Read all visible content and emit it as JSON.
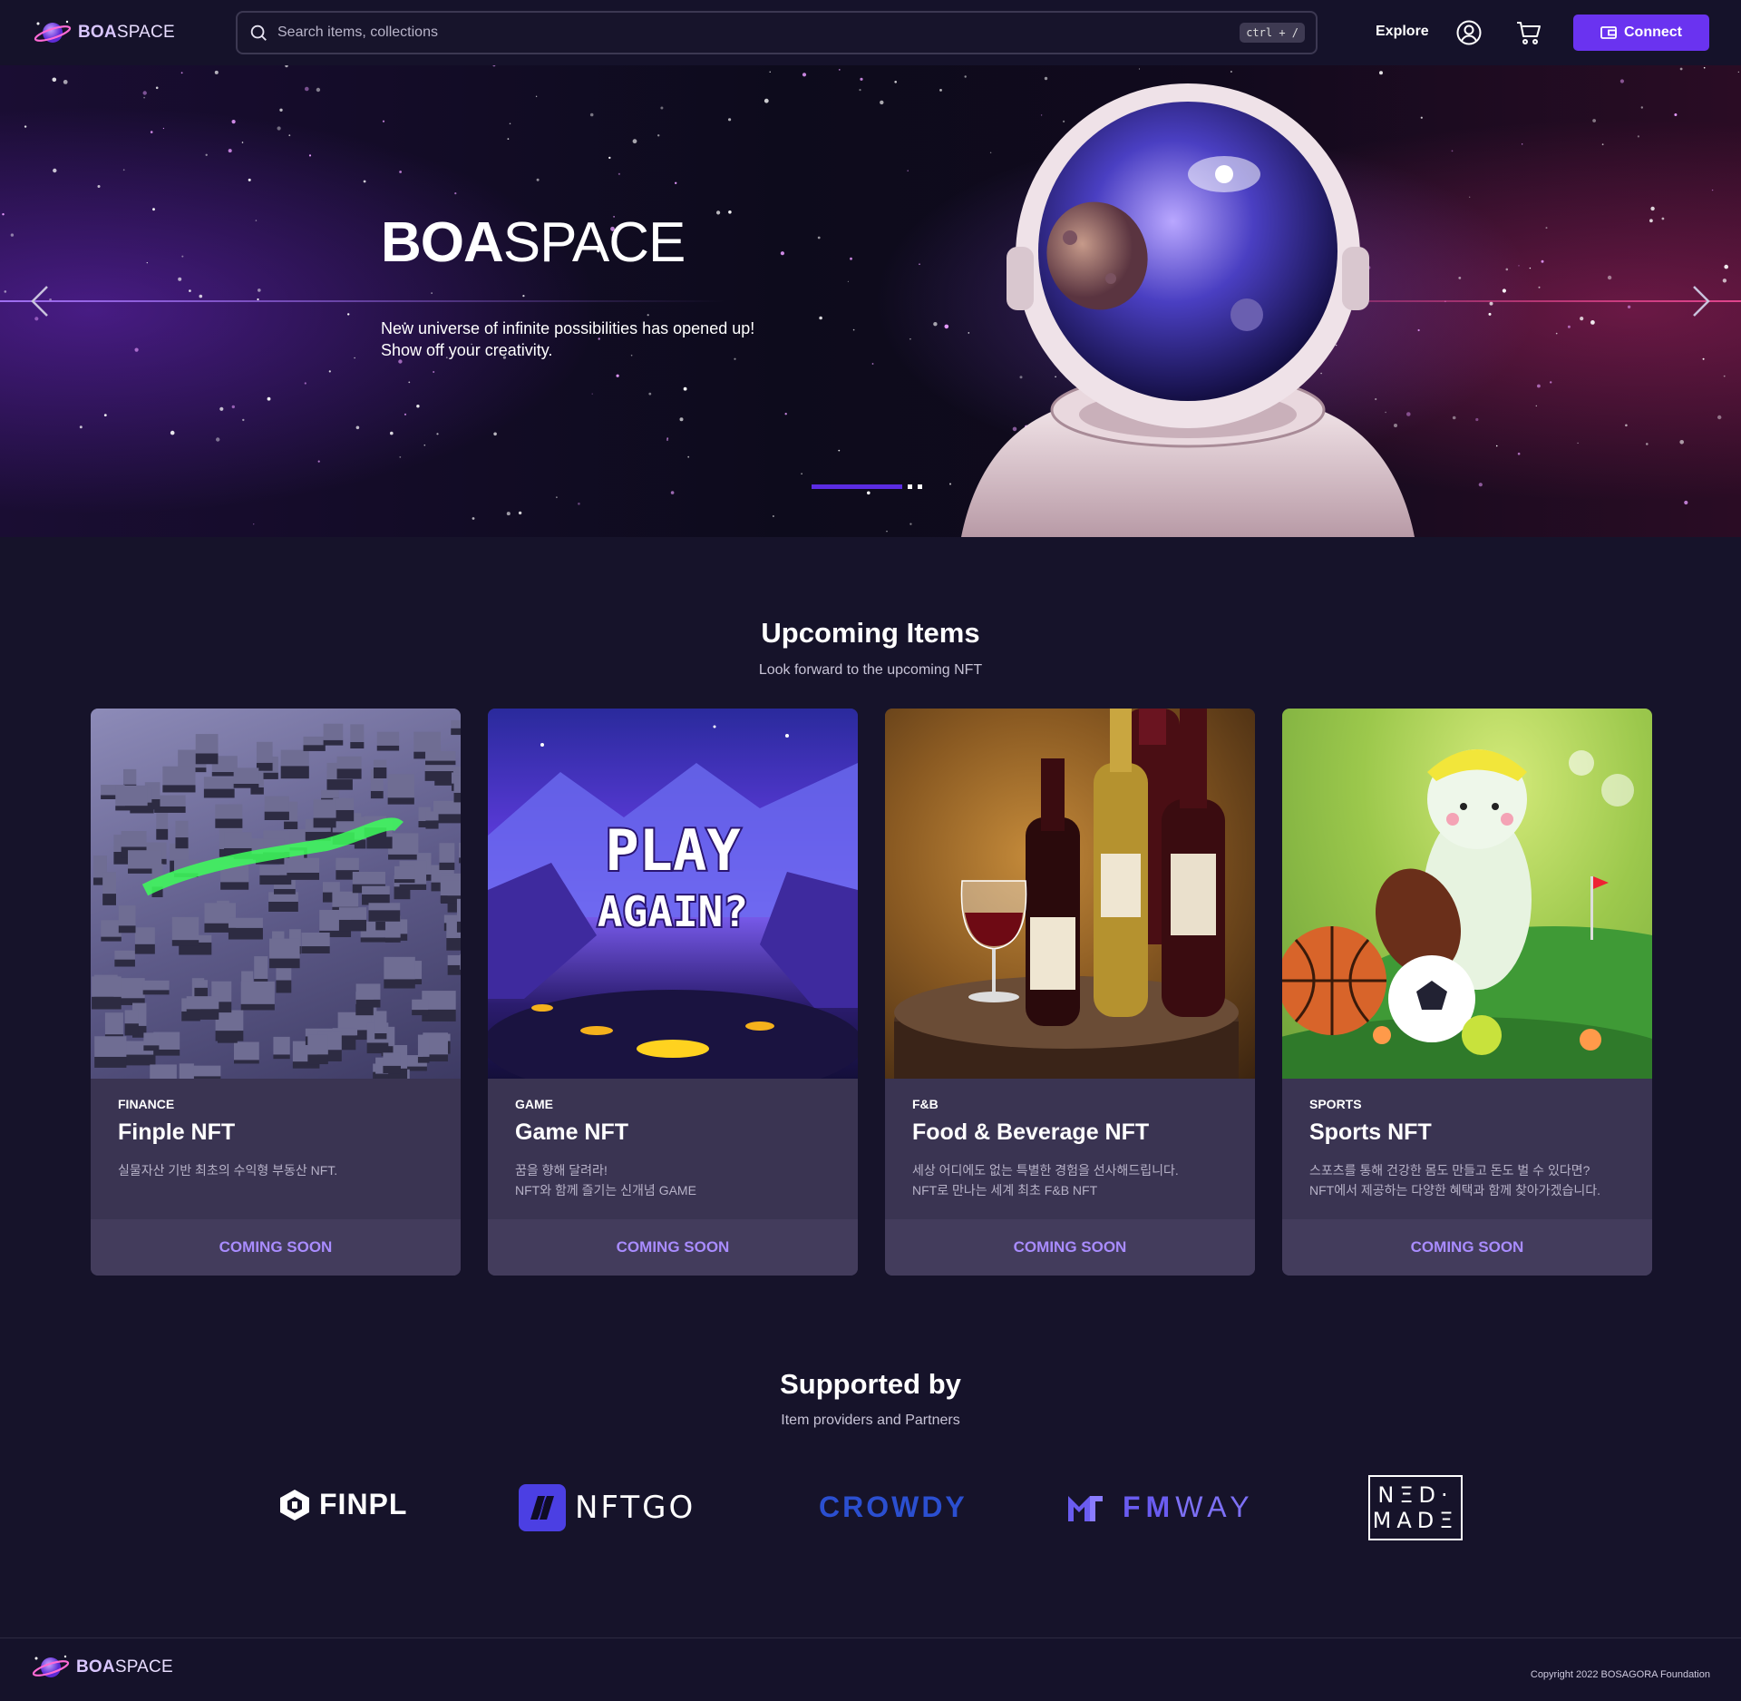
{
  "header": {
    "logo_bold": "BOA",
    "logo_light": "SPACE",
    "search_placeholder": "Search items, collections",
    "search_shortcut": "ctrl + /",
    "nav_explore": "Explore",
    "connect_label": "Connect"
  },
  "hero": {
    "title_bold": "BOA",
    "title_light": "SPACE",
    "subtitle_line1": "New universe of infinite possibilities has opened up!",
    "subtitle_line2": "Show off your creativity.",
    "active_slide": 1,
    "slide_count": 3
  },
  "upcoming": {
    "title": "Upcoming Items",
    "subtitle": "Look forward to the upcoming NFT",
    "cards": [
      {
        "category": "FINANCE",
        "title": "Finple NFT",
        "description": "실물자산 기반 최초의 수익형 부동산 NFT.",
        "action": "COMING SOON"
      },
      {
        "category": "GAME",
        "title": "Game NFT",
        "description": "꿈을 향해 달려라!\nNFT와 함께 즐기는 신개념 GAME",
        "action": "COMING SOON",
        "image_text_1": "PLAY",
        "image_text_2": "AGAIN?"
      },
      {
        "category": "F&B",
        "title": "Food & Beverage NFT",
        "description": "세상 어디에도 없는 특별한 경험을 선사해드립니다.\nNFT로 만나는 세계 최초 F&B NFT",
        "action": "COMING SOON"
      },
      {
        "category": "SPORTS",
        "title": "Sports NFT",
        "description": "스포츠를 통해 건강한 몸도 만들고 돈도 벌 수 있다면?\nNFT에서 제공하는 다양한 혜택과 함께 찾아가겠습니다.",
        "action": "COMING SOON"
      }
    ]
  },
  "supported": {
    "title": "Supported by",
    "subtitle": "Item providers and Partners",
    "partners": [
      "FINPL",
      "NFTGO",
      "CROWDY",
      "FMWAY",
      "NEED MADE"
    ],
    "nftgo_text": "NFTGO",
    "fmway_fm": "FM",
    "fmway_way": "WAY",
    "needmade_line1": "NΞD·",
    "needmade_line2": "MADΞ"
  },
  "footer": {
    "logo_bold": "BOA",
    "logo_light": "SPACE",
    "copyright": "Copyright 2022 BOSAGORA Foundation"
  },
  "colors": {
    "background": "#16132a",
    "accent": "#6a33f0",
    "card": "#3a3452",
    "coming_soon": "#a98cff"
  },
  "icons": [
    "search-icon",
    "user-icon",
    "cart-icon",
    "wallet-icon",
    "chevron-left-icon",
    "chevron-right-icon",
    "planet-logo-icon"
  ]
}
